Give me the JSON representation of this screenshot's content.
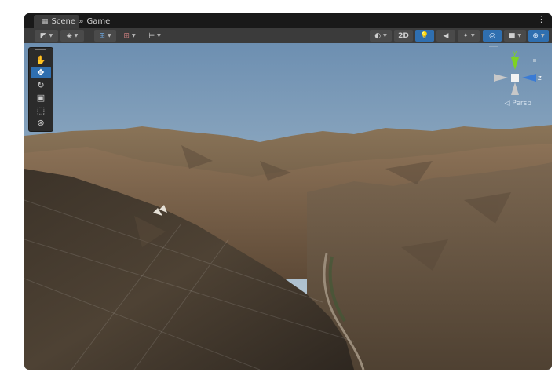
{
  "tabs": [
    {
      "label": "Scene",
      "icon": "grid-icon",
      "active": true
    },
    {
      "label": "Game",
      "icon": "gamepad-icon",
      "active": false
    }
  ],
  "toolbar": {
    "mode_2d_label": "2D"
  },
  "gizmo": {
    "y_label": "y",
    "z_label": "z",
    "projection_label": "◁ Persp",
    "colors": {
      "y": "#7ed321",
      "z": "#3a7bd5",
      "neutral": "#c8c8c8"
    }
  },
  "scene": {
    "sky_top": "#6e8fb0",
    "sky_horizon": "#c9d6df"
  }
}
